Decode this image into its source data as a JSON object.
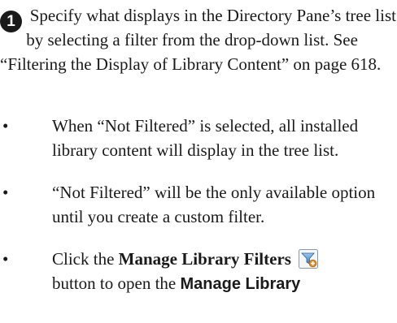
{
  "step": {
    "number": "1",
    "text": "Specify what displays in the Directory Pane’s tree list by selecting a filter from the drop-down list. See “Filtering the Display of Library Content” on page 618."
  },
  "bullets": [
    {
      "marker": "•",
      "text": "When “Not Filtered” is selected, all installed library content will display in the tree list."
    },
    {
      "marker": "•",
      "text": "“Not Filtered” will be the only available option until you create a custom filter."
    },
    {
      "marker": "•",
      "prefix": "Click the ",
      "bold": "Manage Library Filters",
      "icon": "manage-library-filters-icon",
      "middle": " button to open the ",
      "bold2": "Manage Library"
    }
  ]
}
